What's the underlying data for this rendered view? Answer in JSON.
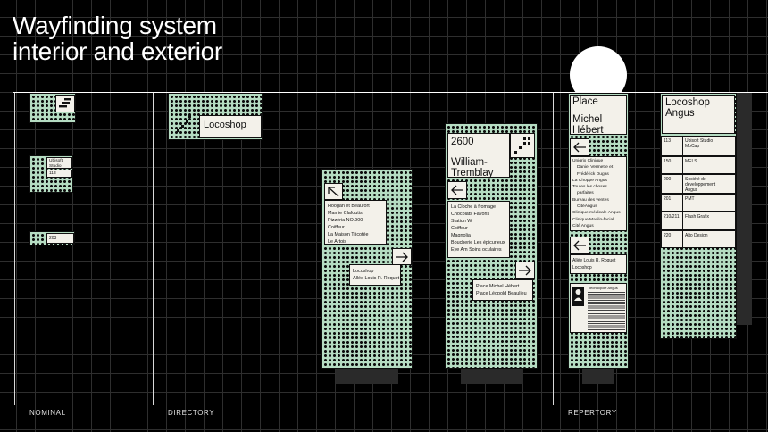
{
  "title": {
    "line1": "Wayfinding system",
    "line2": "interior and exterior"
  },
  "sections": {
    "nominal": "NOMINAL",
    "directory": "DIRECTORY",
    "repertory": "REPERTORY"
  },
  "nominal": {
    "sign2": {
      "name": "Ubisoft Studio",
      "number": "113"
    },
    "sign3": {
      "number": "203"
    }
  },
  "directory": {
    "locoshop_sign": {
      "label": "Locoshop"
    },
    "pylon1": {
      "list1": [
        "Hoogan et Beaufort",
        "Mamie Clafoutis",
        "Pizzéria NO.900",
        "Coiffeur",
        "La Maison Tricotée",
        "Le Artois"
      ],
      "list2": [
        "Locoshop",
        "Allée Louis R. Roquet"
      ]
    },
    "pylon2": {
      "header_number": "2600",
      "header_street": "William-Tremblay",
      "list1": [
        "La Cloche à fromage",
        "Chocolats Favoris",
        "Station W",
        "Coiffeur",
        "Magnolia",
        "Boucherie Les épicurieux",
        "Eye Am Soins oculaires"
      ],
      "list2": [
        "Place Michel Hébert",
        "Place Léopold Beaulieu"
      ]
    }
  },
  "repertory": {
    "tower": {
      "line1": "Place",
      "line2": "Michel",
      "line3": "Hébert",
      "list1": [
        "Unigrix Clinique",
        "Daniel Vermette et",
        "Frédérick Dugas",
        "La Choppe Angus",
        "Toutes les choses",
        "parfaites",
        "Bureau des ventes",
        "CitéAngus",
        "Clinique médicale Angus",
        "Clinique Maxilo-facial",
        "Cité Angus"
      ],
      "list2": [
        "Allée Louis R. Roquet",
        "Locoshop"
      ],
      "info_title": "Technopole Angus"
    },
    "board": {
      "title_line1": "Locoshop",
      "title_line2": "Angus",
      "rows": [
        {
          "num": "113",
          "name": "Ubisoft Studio MoCap"
        },
        {
          "num": "150",
          "name": "MELS"
        },
        {
          "num": "200",
          "name": "Société de développement Angus"
        },
        {
          "num": "201",
          "name": "PMT"
        },
        {
          "num": "210/211",
          "name": "Flash Grafix"
        },
        {
          "num": "220",
          "name": "Alto Design"
        }
      ]
    }
  },
  "colors": {
    "background": "#000000",
    "sign_green": "#b5dcc2",
    "card": "#f3f1ea",
    "ink": "#0d0d0d"
  }
}
